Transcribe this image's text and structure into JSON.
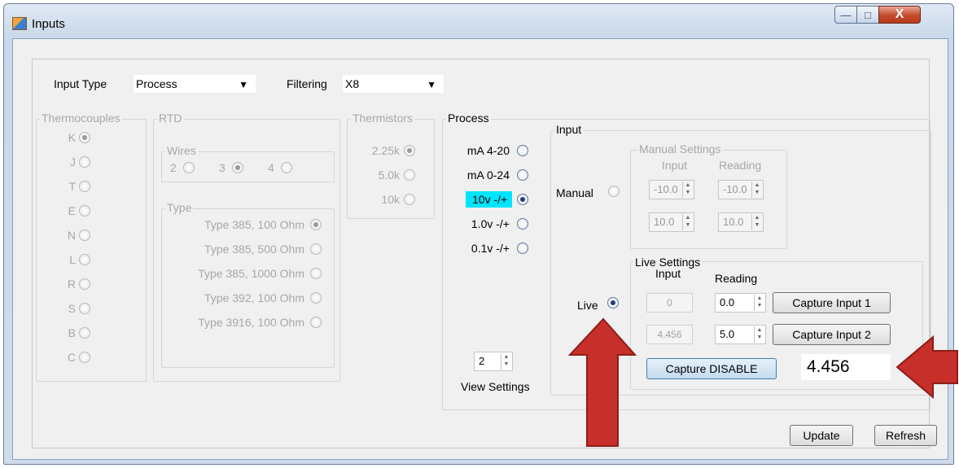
{
  "window": {
    "title": "Inputs",
    "minimize_glyph": "—",
    "maximize_glyph": "□",
    "close_glyph": "X"
  },
  "top": {
    "input_type_label": "Input Type",
    "input_type_value": "Process",
    "filtering_label": "Filtering",
    "filtering_value": "X8"
  },
  "thermocouples": {
    "title": "Thermocouples",
    "items": [
      "K",
      "J",
      "T",
      "E",
      "N",
      "L",
      "R",
      "S",
      "B",
      "C"
    ],
    "selected": "K"
  },
  "rtd": {
    "title": "RTD",
    "wires": {
      "title": "Wires",
      "options": [
        "2",
        "3",
        "4"
      ],
      "selected": "3"
    },
    "type": {
      "title": "Type",
      "options": [
        "Type 385, 100 Ohm",
        "Type 385, 500 Ohm",
        "Type 385, 1000 Ohm",
        "Type 392, 100 Ohm",
        "Type 3916, 100 Ohm"
      ],
      "selected": "Type 385, 100 Ohm"
    }
  },
  "thermistors": {
    "title": "Thermistors",
    "options": [
      "2.25k",
      "5.0k",
      "10k"
    ],
    "selected": "2.25k"
  },
  "process": {
    "title": "Process",
    "ranges": [
      "mA 4-20",
      "mA 0-24",
      "10v -/+",
      "1.0v -/+",
      "0.1v -/+"
    ],
    "selected": "10v -/+",
    "view_settings_value": "2",
    "view_settings_label": "View Settings",
    "input": {
      "title": "Input",
      "manual_label": "Manual",
      "live_label": "Live",
      "mode": "Live",
      "manual_settings": {
        "title": "Manual Settings",
        "input_header": "Input",
        "reading_header": "Reading",
        "rows": [
          {
            "input": "-10.0",
            "reading": "-10.0"
          },
          {
            "input": "10.0",
            "reading": "10.0"
          }
        ]
      },
      "live_settings": {
        "title": "Live Settings",
        "input_header": "Input",
        "reading_header": "Reading",
        "rows": [
          {
            "input": "0",
            "reading": "0.0",
            "capture_label": "Capture Input 1"
          },
          {
            "input": "4.456",
            "reading": "5.0",
            "capture_label": "Capture Input 2"
          }
        ],
        "capture_disable_label": "Capture DISABLE",
        "live_value": "4.456"
      }
    }
  },
  "footer": {
    "update_label": "Update",
    "refresh_label": "Refresh"
  },
  "colors": {
    "highlight": "#00e5ff",
    "arrow": "#c62f2a"
  }
}
